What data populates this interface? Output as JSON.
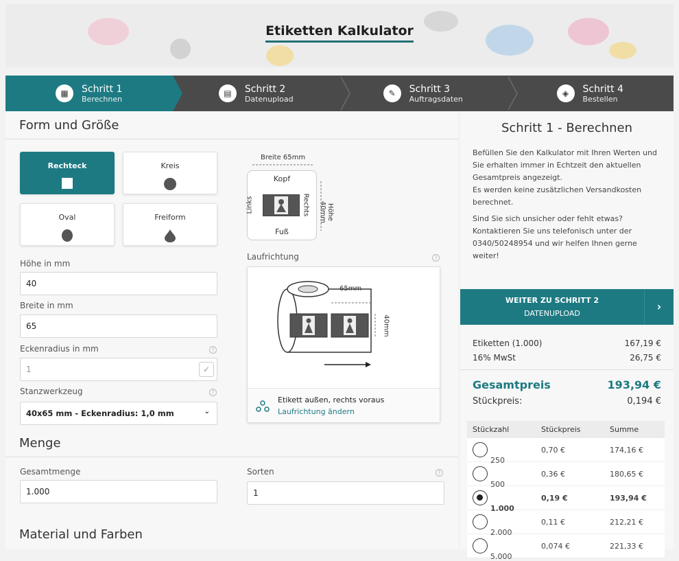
{
  "header": {
    "title": "Etiketten Kalkulator"
  },
  "steps": [
    {
      "title": "Schritt 1",
      "subtitle": "Berechnen",
      "icon": "calculator-icon"
    },
    {
      "title": "Schritt 2",
      "subtitle": "Datenupload",
      "icon": "file-icon"
    },
    {
      "title": "Schritt 3",
      "subtitle": "Auftragsdaten",
      "icon": "document-edit-icon"
    },
    {
      "title": "Schritt 4",
      "subtitle": "Bestellen",
      "icon": "box-icon"
    }
  ],
  "form": {
    "section_title": "Form und Größe",
    "shapes": {
      "rect": "Rechteck",
      "circle": "Kreis",
      "oval": "Oval",
      "free": "Freiform"
    },
    "height_label": "Höhe in mm",
    "height_value": "40",
    "width_label": "Breite in mm",
    "width_value": "65",
    "radius_label": "Eckenradius in mm",
    "radius_value": "1",
    "tool_label": "Stanzwerkzeug",
    "tool_value": "40x65 mm - Eckenradius: 1,0 mm",
    "preview": {
      "width": "Breite 65mm",
      "top": "Kopf",
      "bottom": "Fuß",
      "left": "Links",
      "right": "Rechts",
      "height": "Höhe 40mm"
    },
    "direction_label": "Laufrichtung",
    "roll_width": "65mm",
    "roll_height": "40mm",
    "direction_text": "Etikett außen, rechts voraus",
    "direction_link": "Laufrichtung ändern"
  },
  "quantity": {
    "section_title": "Menge",
    "total_label": "Gesamtmenge",
    "total_value": "1.000",
    "sorts_label": "Sorten",
    "sorts_value": "1"
  },
  "material": {
    "section_title": "Material und Farben"
  },
  "summary": {
    "title": "Schritt 1 - Berechnen",
    "p1": "Befüllen Sie den Kalkulator mit Ihren Werten und Sie erhalten immer in Echtzeit den aktuellen Gesamtpreis angezeigt.",
    "p2": "Es werden keine zusätzlichen Versandkosten berechnet.",
    "p3": "Sind Sie sich unsicher oder fehlt etwas? Kontaktieren Sie uns telefonisch unter der 0340/50248954 und wir helfen Ihnen gerne weiter!",
    "cta_line1": "WEITER ZU SCHRITT 2",
    "cta_line2": "DATENUPLOAD",
    "cta_arrow": "›",
    "labels_label": "Etiketten (1.000)",
    "labels_value": "167,19 €",
    "vat_label": "16% MwSt",
    "vat_value": "26,75 €",
    "total_label": "Gesamtpreis",
    "total_value": "193,94 €",
    "unit_label": "Stückpreis:",
    "unit_value": "0,194 €"
  },
  "table": {
    "headers": [
      "Stückzahl",
      "Stückpreis",
      "Summe"
    ],
    "rows": [
      {
        "qty": "250",
        "unit": "0,70 €",
        "sum": "174,16 €",
        "selected": false
      },
      {
        "qty": "500",
        "unit": "0,36 €",
        "sum": "180,65 €",
        "selected": false
      },
      {
        "qty": "1.000",
        "unit": "0,19 €",
        "sum": "193,94 €",
        "selected": true
      },
      {
        "qty": "2.000",
        "unit": "0,11 €",
        "sum": "212,21 €",
        "selected": false
      },
      {
        "qty": "5.000",
        "unit": "0,074 €",
        "sum": "221,33 €",
        "selected": false
      }
    ]
  },
  "colors": {
    "accent": "#1d7a82",
    "dark_step": "#4a4a4a"
  }
}
